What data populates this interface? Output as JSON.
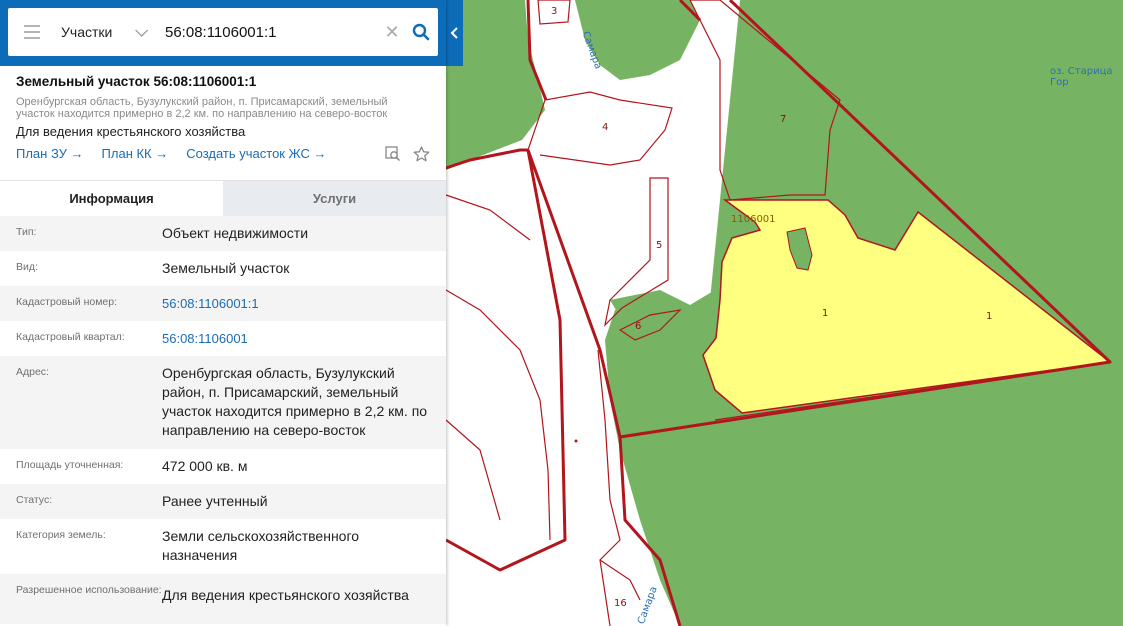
{
  "search": {
    "category": "Участки",
    "value": "56:08:1106001:1"
  },
  "parcel": {
    "title": "Земельный участок 56:08:1106001:1",
    "address_short": "Оренбургская область, Бузулукский район, п. Присамарский, земельный участок находится примерно в 2,2 км. по направлению на северо-восток",
    "use": "Для ведения крестьянского хозяйства",
    "links": [
      "План ЗУ →",
      "План КК →",
      "Создать участок ЖС →"
    ]
  },
  "tabs": [
    {
      "label": "Информация",
      "active": true
    },
    {
      "label": "Услуги",
      "active": false
    }
  ],
  "info": [
    {
      "label": "Тип:",
      "value": "Объект недвижимости",
      "link": false
    },
    {
      "label": "Вид:",
      "value": "Земельный участок",
      "link": false
    },
    {
      "label": "Кадастровый номер:",
      "value": "56:08:1106001:1",
      "link": true
    },
    {
      "label": "Кадастровый квартал:",
      "value": "56:08:1106001",
      "link": true
    },
    {
      "label": "Адрес:",
      "value": "Оренбургская область, Бузулукский район, п. Присамарский, земельный участок находится примерно в 2,2 км. по направлению на северо-восток",
      "link": false
    },
    {
      "label": "Площадь уточненная:",
      "value": "472 000 кв. м",
      "link": false
    },
    {
      "label": "Статус:",
      "value": "Ранее учтенный",
      "link": false
    },
    {
      "label": "Категория земель:",
      "value": "Земли сельскохозяйственного назначения",
      "link": false
    },
    {
      "label": "Разрешенное использование:",
      "value": "Для ведения крестьянского хозяйства",
      "link": false
    }
  ],
  "map": {
    "parcel_labels": [
      "3",
      "4",
      "7",
      "5",
      "6",
      "1",
      "1",
      "16"
    ],
    "quarter_label": "1106001",
    "water_labels": [
      "Самара",
      "Самара",
      "оз. Старица Гор"
    ]
  },
  "colors": {
    "header_blue": "#0d6cb8",
    "link_blue": "#1a6cb4",
    "forest_green": "#76b363",
    "selected_parcel": "#ffff80",
    "boundary_red": "#b3151c"
  },
  "icons": [
    "menu-icon",
    "chevron-down-icon",
    "clear-icon",
    "search-icon",
    "chevron-left-icon",
    "zoom-plan-icon",
    "star-icon"
  ]
}
